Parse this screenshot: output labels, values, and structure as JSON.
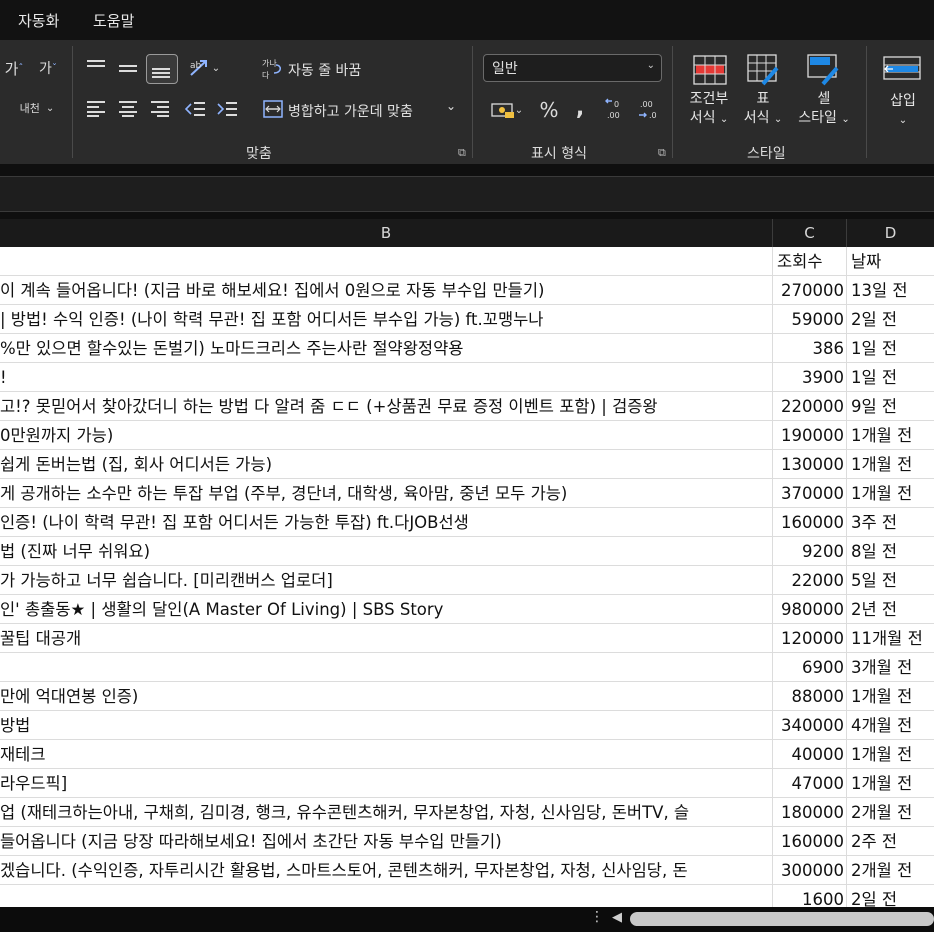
{
  "menu": {
    "items": [
      "자동화",
      "도움말"
    ]
  },
  "ribbon": {
    "alignment": {
      "wrap_text": "자동 줄 바꿈",
      "merge_center": "병합하고 가운데 맞춤",
      "label": "맞춤",
      "font_grow": "가",
      "font_shrink": "가",
      "ruby": "내천"
    },
    "number": {
      "format_value": "일반",
      "percent": "%",
      "comma": ",",
      "label": "표시 형식"
    },
    "styles": {
      "conditional_line1": "조건부",
      "conditional_line2": "서식",
      "table_line1": "표",
      "table_line2": "서식",
      "cell_line1": "셀",
      "cell_line2": "스타일",
      "label": "스타일"
    },
    "cells": {
      "insert": "삽입"
    }
  },
  "columns": [
    "B",
    "C",
    "D"
  ],
  "rows": [
    {
      "b": "",
      "c": "조회수",
      "d": "날짜"
    },
    {
      "b": "이 계속 들어옵니다! (지금 바로 해보세요! 집에서 0원으로 자동 부수입 만들기)",
      "c": "270000",
      "d": "13일 전"
    },
    {
      "b": "| 방법! 수익 인증! (나이 학력 무관! 집 포함 어디서든 부수입 가능) ft.꼬맹누나",
      "c": "59000",
      "d": "2일 전"
    },
    {
      "b": "%만 있으면 할수있는 돈벌기) 노마드크리스 주는사란 절약왕정약용",
      "c": "386",
      "d": "1일 전"
    },
    {
      "b": "!",
      "c": "3900",
      "d": "1일 전"
    },
    {
      "b": "고!? 못믿어서 찾아갔더니 하는 방법 다 알려 줌 ㄷㄷ (+상품권 무료 증정 이벤트 포함) | 검증왕",
      "c": "220000",
      "d": "9일 전"
    },
    {
      "b": "0만원까지 가능)",
      "c": "190000",
      "d": "1개월 전"
    },
    {
      "b": "쉽게 돈버는법 (집, 회사 어디서든 가능)",
      "c": "130000",
      "d": "1개월 전"
    },
    {
      "b": "게 공개하는 소수만 하는 투잡 부업 (주부, 경단녀, 대학생, 육아맘, 중년 모두 가능)",
      "c": "370000",
      "d": "1개월 전"
    },
    {
      "b": "인증! (나이 학력 무관! 집 포함 어디서든 가능한 투잡) ft.다JOB선생",
      "c": "160000",
      "d": "3주 전"
    },
    {
      "b": "법 (진짜 너무 쉬워요)",
      "c": "9200",
      "d": "8일 전"
    },
    {
      "b": "가 가능하고 너무 쉽습니다. [미리캔버스 업로더]",
      "c": "22000",
      "d": "5일 전"
    },
    {
      "b": "인' 총출동★ | 생활의 달인(A Master Of Living) | SBS Story",
      "c": "980000",
      "d": "2년 전"
    },
    {
      "b": "꿀팁 대공개",
      "c": "120000",
      "d": "11개월 전"
    },
    {
      "b": "",
      "c": "6900",
      "d": "3개월 전"
    },
    {
      "b": "만에 억대연봉 인증)",
      "c": "88000",
      "d": "1개월 전"
    },
    {
      "b": "방법",
      "c": "340000",
      "d": "4개월 전"
    },
    {
      "b": "재테크",
      "c": "40000",
      "d": "1개월 전"
    },
    {
      "b": "라우드픽]",
      "c": "47000",
      "d": "1개월 전"
    },
    {
      "b": "업 (재테크하는아내, 구채희, 김미경, 행크, 유수콘텐츠해커, 무자본창업, 자청, 신사임당, 돈버TV, 슬",
      "c": "180000",
      "d": "2개월 전"
    },
    {
      "b": " 들어옵니다 (지금 당장 따라해보세요! 집에서 초간단 자동 부수입 만들기)",
      "c": "160000",
      "d": "2주 전"
    },
    {
      "b": "겠습니다. (수익인증, 자투리시간 활용법, 스마트스토어, 콘텐츠해커, 무자본창업, 자청, 신사임당, 돈",
      "c": "300000",
      "d": "2개월 전"
    },
    {
      "b": "",
      "c": "1600",
      "d": "2일 전"
    }
  ]
}
